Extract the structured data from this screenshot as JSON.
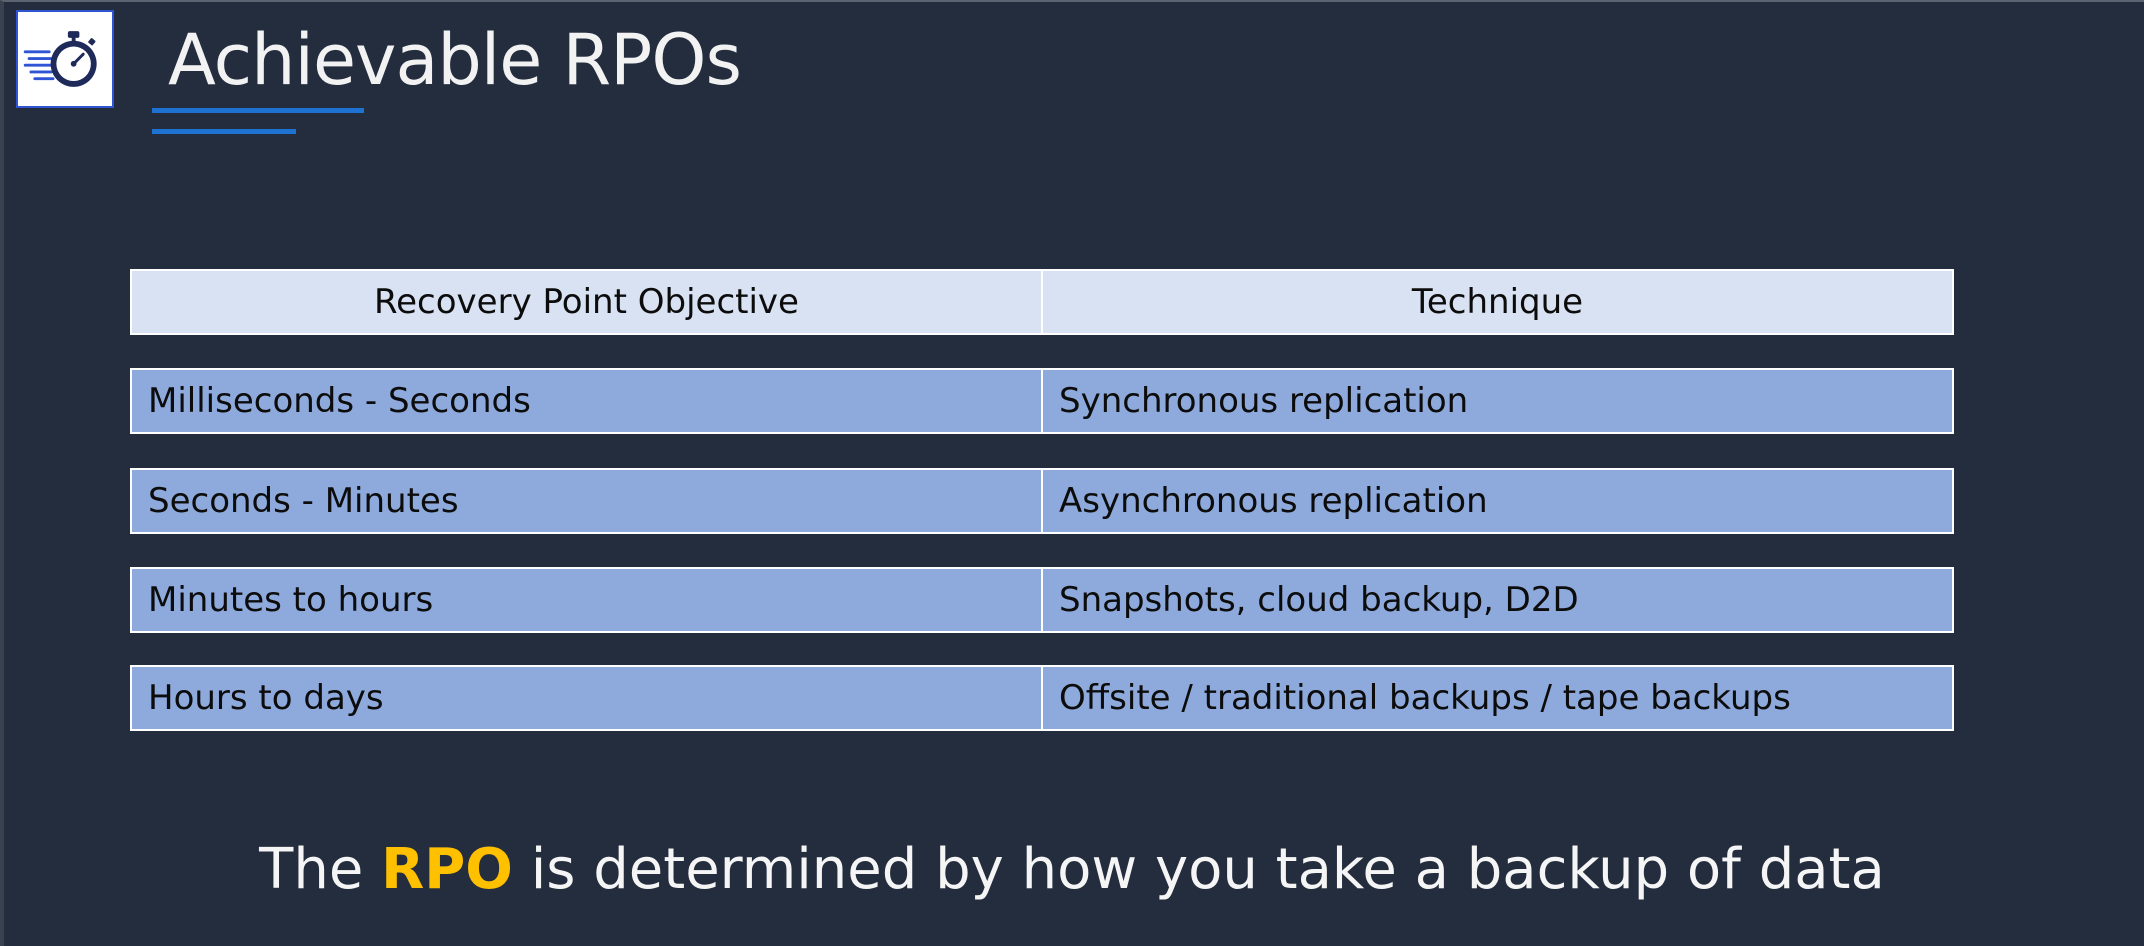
{
  "slide": {
    "title": "Achievable RPOs",
    "logo_icon": "stopwatch-speed-icon",
    "accent_color": "#1e73d2",
    "highlight_color": "#ffc000",
    "background_color": "#232d3e"
  },
  "table": {
    "headers": [
      "Recovery Point Objective",
      "Technique"
    ],
    "rows": [
      [
        "Milliseconds - Seconds",
        "Synchronous replication"
      ],
      [
        "Seconds - Minutes",
        "Asynchronous replication"
      ],
      [
        "Minutes to hours",
        "Snapshots, cloud backup, D2D"
      ],
      [
        "Hours to days",
        "Offsite / traditional backups / tape backups"
      ]
    ]
  },
  "footer": {
    "prefix": "The ",
    "highlight": "RPO",
    "suffix": " is determined by how you take a backup of data"
  }
}
